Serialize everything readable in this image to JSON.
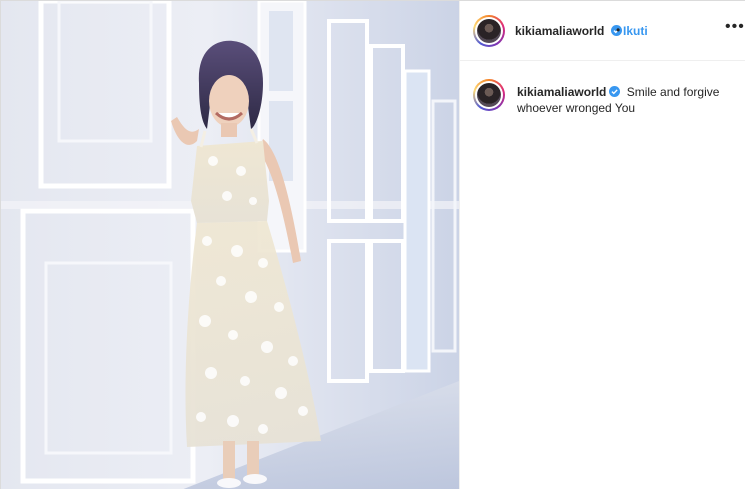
{
  "post": {
    "username": "kikiamaliaworld",
    "separator": "•",
    "follow_label": "Ikuti",
    "more_icon": "more-options-icon",
    "verified_color": "#3897f0"
  },
  "caption": {
    "username": "kikiamaliaworld",
    "text": "Smile and forgive whoever wronged You"
  },
  "photo": {
    "description_icon": "post-photo"
  },
  "colors": {
    "link": "#3897f0",
    "text": "#262626",
    "border": "#dbdbdb"
  }
}
